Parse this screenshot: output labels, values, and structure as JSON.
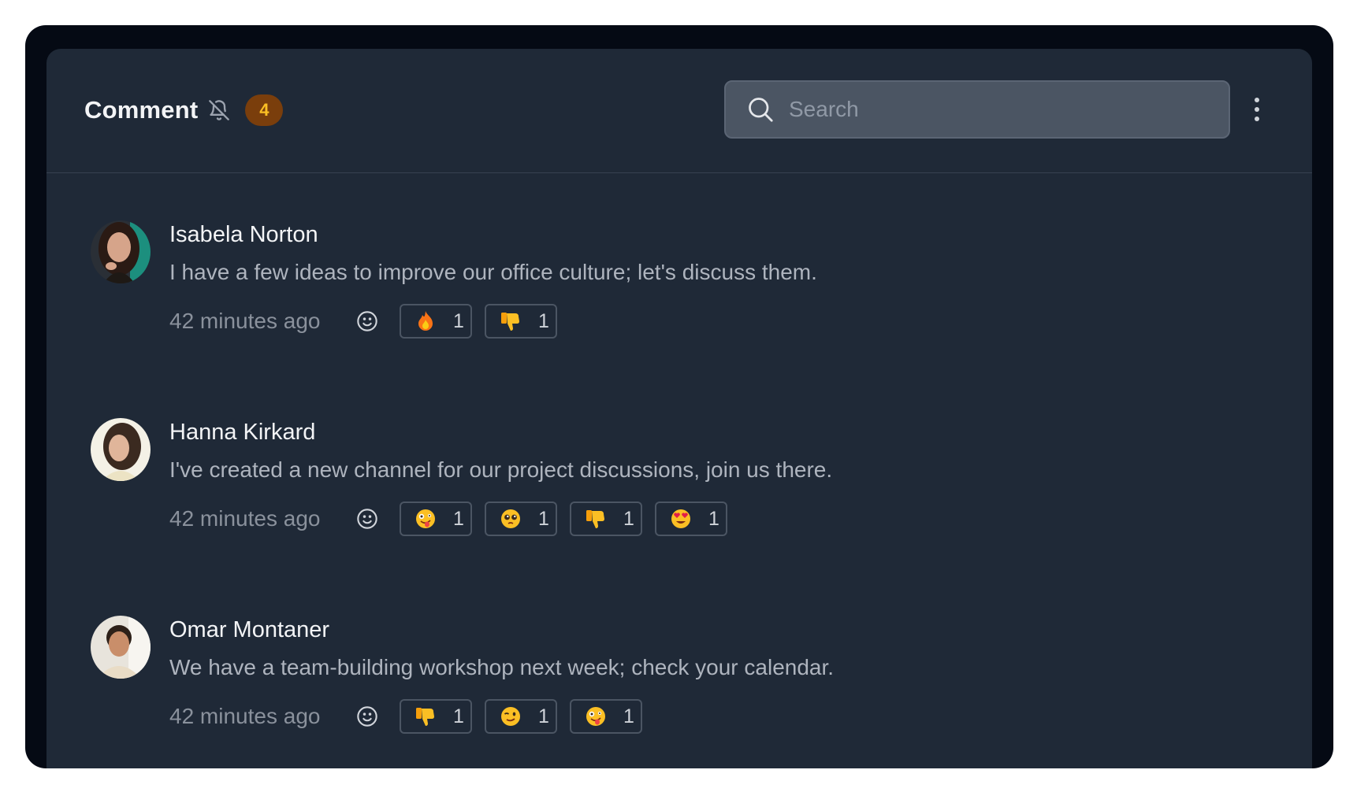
{
  "header": {
    "title": "Comment",
    "notification_icon": "bell-off-icon",
    "count": "4",
    "search_placeholder": "Search",
    "menu_icon": "more-vertical-icon"
  },
  "colors": {
    "frame": "#050a14",
    "panel": "#1f2937",
    "badge_bg": "#7a3e0c",
    "badge_text": "#fbbf24",
    "search_bg": "#4b5563"
  },
  "comments": [
    {
      "author": "Isabela Norton",
      "text": "I have a few ideas to improve our office culture; let's discuss them.",
      "time": "42 minutes ago",
      "reactions": [
        {
          "emoji": "fire",
          "count": "1"
        },
        {
          "emoji": "thumbs-down",
          "count": "1"
        }
      ]
    },
    {
      "author": "Hanna Kirkard",
      "text": "I've created a new channel for our project discussions, join us there.",
      "time": "42 minutes ago",
      "reactions": [
        {
          "emoji": "zany-face",
          "count": "1"
        },
        {
          "emoji": "pleading-face",
          "count": "1"
        },
        {
          "emoji": "thumbs-down",
          "count": "1"
        },
        {
          "emoji": "heart-eyes",
          "count": "1"
        }
      ]
    },
    {
      "author": "Omar Montaner",
      "text": "We have a team-building workshop next week; check your calendar.",
      "time": "42 minutes ago",
      "reactions": [
        {
          "emoji": "thumbs-down",
          "count": "1"
        },
        {
          "emoji": "winking-face",
          "count": "1"
        },
        {
          "emoji": "zany-face",
          "count": "1"
        }
      ]
    }
  ]
}
